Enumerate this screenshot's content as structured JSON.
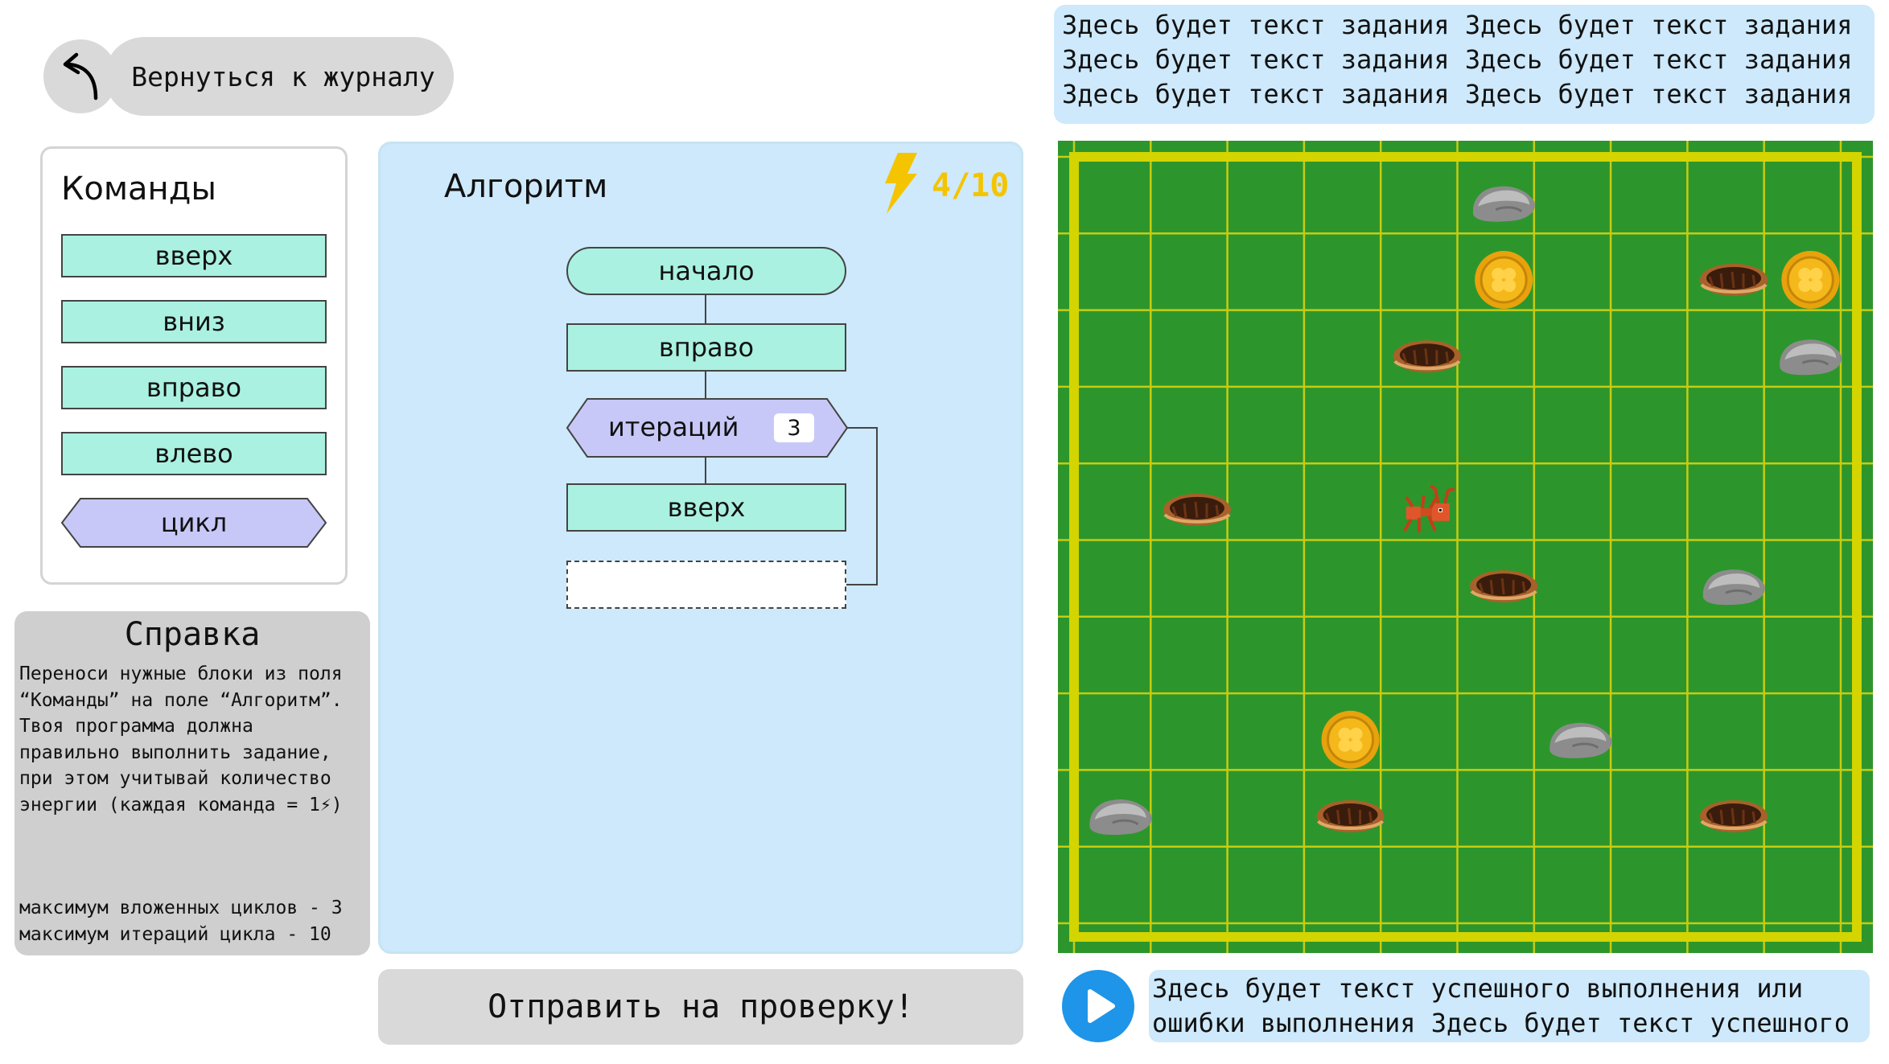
{
  "back": {
    "label": "Вернуться к журналу",
    "icon": "back-arrow-icon"
  },
  "commands": {
    "title": "Команды",
    "items": [
      "вверх",
      "вниз",
      "вправо",
      "влево",
      "цикл"
    ]
  },
  "help": {
    "title": "Справка",
    "body": "Переноси нужные блоки из поля\n“Команды” на поле “Алгоритм”.\nТвоя программа должна\nправильно выполнить задание,\nпри этом учитывай количество\nэнергии (каждая команда = 1⚡)",
    "limit_nested": "максимум вложенных циклов - 3",
    "limit_iterations": "максимум итераций цикла - 10"
  },
  "algorithm": {
    "title": "Алгоритм",
    "energy": "4/10",
    "start": "начало",
    "blocks": [
      "вправо",
      "итераций",
      "вверх"
    ],
    "iterations": "3"
  },
  "submit": {
    "label": "Отправить на проверку!"
  },
  "task": {
    "text": "Здесь будет текст задания Здесь будет текст задания\nЗдесь будет текст задания Здесь будет текст задания\nЗдесь будет текст задания Здесь будет текст задания"
  },
  "result": {
    "text": "Здесь будет текст успешного выполнения или\nошибки выполнения Здесь будет текст успешного"
  },
  "colors": {
    "command_block": "#aaf1e1",
    "loop_block": "#c8c8f8",
    "panel_blue": "#cde9fb",
    "grass": "#2c962c",
    "grid_line": "#d4d400",
    "energy": "#f5c400",
    "play": "#1e95e8"
  },
  "board": {
    "columns": 10,
    "rows": 10,
    "ant": {
      "col": 4,
      "row": 4
    },
    "rocks": [
      [
        5,
        0
      ],
      [
        9,
        2
      ],
      [
        8,
        5
      ],
      [
        6,
        7
      ],
      [
        0,
        8
      ]
    ],
    "coins": [
      [
        5,
        1
      ],
      [
        9,
        1
      ],
      [
        3,
        7
      ]
    ],
    "holes": [
      [
        8,
        1
      ],
      [
        4,
        2
      ],
      [
        1,
        4
      ],
      [
        5,
        5
      ],
      [
        3,
        8
      ],
      [
        8,
        8
      ]
    ]
  }
}
